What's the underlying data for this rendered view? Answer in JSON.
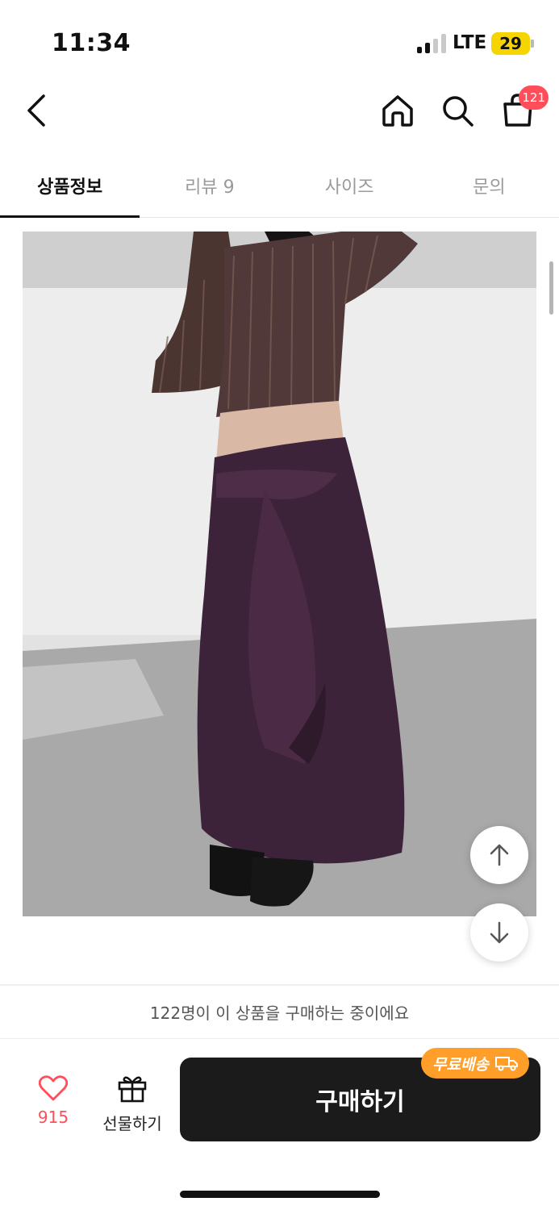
{
  "status_bar": {
    "time": "11:34",
    "network": "LTE",
    "battery": "29"
  },
  "header": {
    "back_icon": "chevron-left-icon",
    "home_icon": "home-icon",
    "search_icon": "search-icon",
    "cart_icon": "shopping-bag-icon",
    "cart_badge": "121"
  },
  "tabs": [
    {
      "label": "상품정보",
      "active": true
    },
    {
      "label": "리뷰 9",
      "active": false
    },
    {
      "label": "사이즈",
      "active": false
    },
    {
      "label": "문의",
      "active": false
    }
  ],
  "product_image": {
    "description_icon": "product-photo"
  },
  "scroll_buttons": {
    "up_icon": "arrow-up-icon",
    "down_icon": "arrow-down-icon"
  },
  "buyer_notice": "122명이 이 상품을 구매하는 중이에요",
  "actions": {
    "like_count": "915",
    "gift_label": "선물하기",
    "buy_label": "구매하기",
    "free_shipping_badge": "무료배송"
  },
  "colors": {
    "accent_red": "#ff4d5a",
    "buy_button": "#1b1b1b",
    "shipping_badge": "#ff9f2a",
    "battery": "#f5d400"
  }
}
